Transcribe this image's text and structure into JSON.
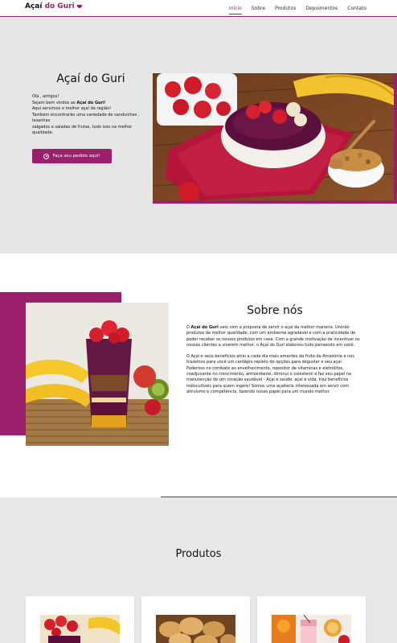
{
  "header": {
    "logo_part1": "Açaí ",
    "logo_part2": "do Guri",
    "nav": [
      {
        "label": "Início"
      },
      {
        "label": "Sobre"
      },
      {
        "label": "Produtos"
      },
      {
        "label": "Depoimentos"
      },
      {
        "label": "Contato"
      }
    ]
  },
  "hero": {
    "title": "Açaí do Guri",
    "line1": "Olá , amigos!",
    "line2_prefix": "Sejam bem vindos ao ",
    "line2_brand": "Açaí do Guri",
    "line2_suffix": "!",
    "line3": "Aqui servimos o melhor açaí da região!",
    "line4": "Também encontrarão uma variedade de sanduiches , lasanhas",
    "line5": "salgados e saladas de frutas, tudo isso na melhor qualidade.",
    "button_label": "Faça seu pedido aqui!"
  },
  "sobre": {
    "title": "Sobre nós",
    "p1_prefix": "O ",
    "p1_brand": "Açaí do Guri",
    "p1_rest": " veio com a proposta de servir o açaí da melhor maneira. Unindo produtos da melhor qualidade, com um ambiente agradável e com a praticidade de poder receber os nossos produtos em casa. Com a grande motivação de incentivar os nossos clientes a viverem melhor, o Açaí do Guri elaborou tudo pensando em você.",
    "p2": "O Açaí e seus benefícios atrai a cada dia mais amantes da fruta da Amazônia e nós trazemos para você um cardápio repleto de opções para degustar o seu açaí. Poderoso no combate ao envelhecimento, repositor de vitaminas e eletrólitos, coadjuvante no crescimento, antioxidante, diminui o colesterol e faz seu papel na manutenção de um coração saudável - Açaí é saúde, açaí é vida, traz benefícios indiscutíveis para quem ingere! Somos uma açaiteria interessada em servir com altruísmo e competência, fazendo nosso papel para um mundo melhor."
  },
  "produtos": {
    "title": "Produtos"
  },
  "colors": {
    "accent": "#9c1f6b",
    "hero_bg": "#e6e6e6"
  }
}
